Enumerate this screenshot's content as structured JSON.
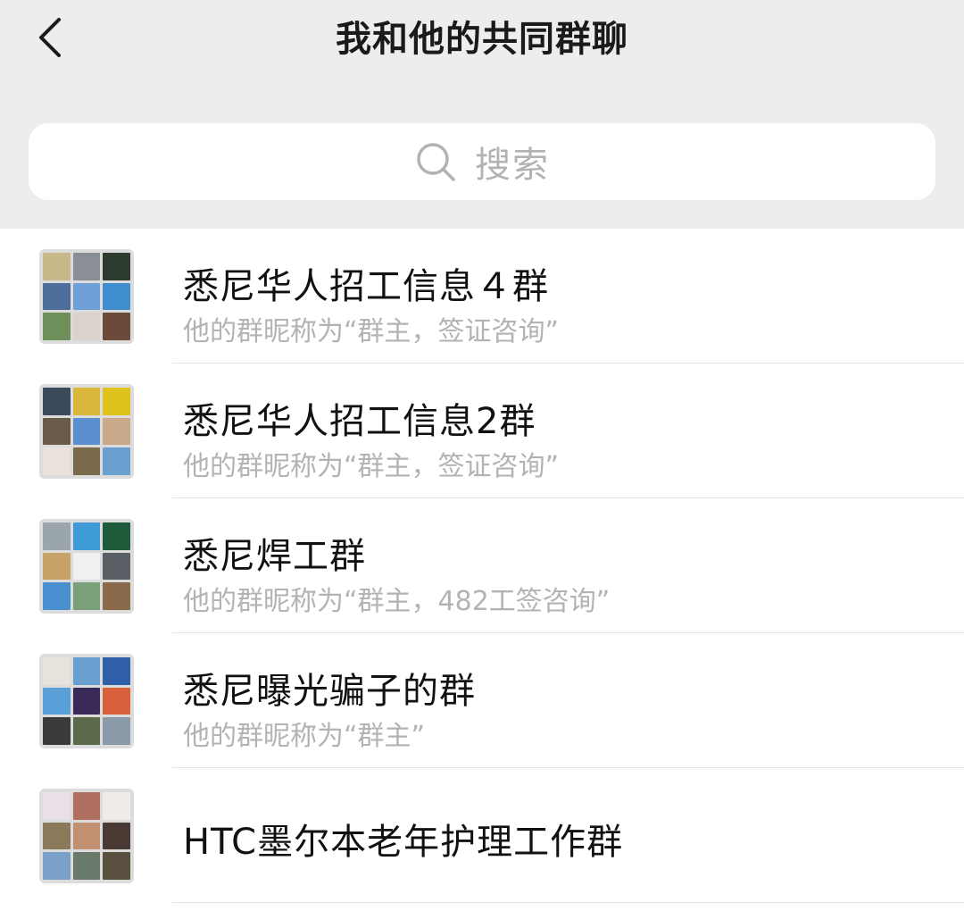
{
  "header": {
    "title": "我和他的共同群聊",
    "back_icon": "chevron-left-icon"
  },
  "search": {
    "placeholder": "搜索",
    "icon": "search-icon"
  },
  "groups": [
    {
      "name": "悉尼华人招工信息４群",
      "nickname_note": "他的群昵称为“群主，签证咨询”",
      "avatar_colors": [
        "#c8b98a",
        "#8a8f96",
        "#2e3b2f",
        "#4d6e9a",
        "#6fa0d8",
        "#3f8fd0",
        "#6d8f5a",
        "#d9d3cc",
        "#6b4a3a"
      ]
    },
    {
      "name": "悉尼华人招工信息2群",
      "nickname_note": "他的群昵称为“群主，签证咨询”",
      "avatar_colors": [
        "#3a4a5a",
        "#d9b73a",
        "#e0c21c",
        "#6a5a4a",
        "#5a8fd0",
        "#c9a98a",
        "#e8e2da",
        "#7a6a4a",
        "#6aa0d0"
      ]
    },
    {
      "name": "悉尼焊工群",
      "nickname_note": "他的群昵称为“群主，482工签咨询”",
      "avatar_colors": [
        "#9aa5ac",
        "#3f9ad8",
        "#1f5a3a",
        "#c7a36a",
        "#eef0f2",
        "#5a5f66",
        "#4a8fcf",
        "#7aa07a",
        "#8a6a4a"
      ]
    },
    {
      "name": "悉尼曝光骗子的群",
      "nickname_note": "他的群昵称为“群主”",
      "avatar_colors": [
        "#e6e2dc",
        "#6aa0d0",
        "#2f5fa8",
        "#5aa0d8",
        "#3a2a5a",
        "#d8603a",
        "#3a3a3a",
        "#5a6a4a",
        "#8a9aa8"
      ]
    },
    {
      "name": "HTC墨尔本老年护理工作群",
      "nickname_note": "",
      "avatar_colors": [
        "#e8e0e6",
        "#b07060",
        "#f0ece8",
        "#8a7a5a",
        "#c09070",
        "#4a3a34",
        "#7aa0c8",
        "#6a7a6a",
        "#5a5040"
      ]
    }
  ]
}
